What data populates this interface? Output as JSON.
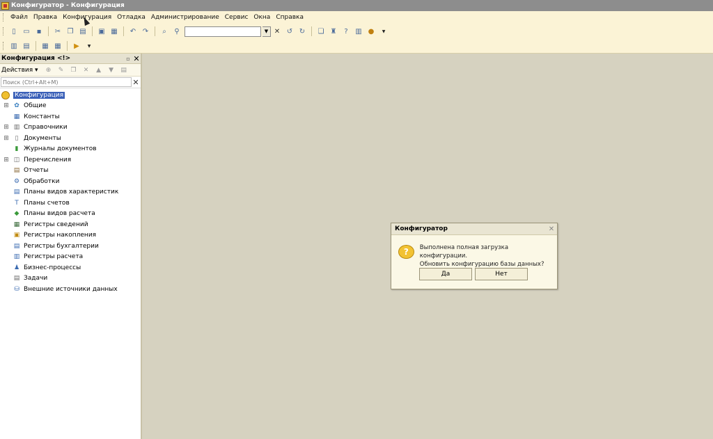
{
  "window": {
    "title": "Конфигуратор - Конфигурация"
  },
  "menu": [
    "Файл",
    "Правка",
    "Конфигурация",
    "Отладка",
    "Администрирование",
    "Сервис",
    "Окна",
    "Справка"
  ],
  "panel": {
    "title": "Конфигурация <!>",
    "actions_label": "Действия",
    "search_placeholder": "Поиск (Ctrl+Alt+M)"
  },
  "tree": {
    "root": "Конфигурация",
    "items": [
      {
        "label": "Общие",
        "expandable": true,
        "icon": "common-icon"
      },
      {
        "label": "Константы",
        "expandable": false,
        "icon": "constants-icon"
      },
      {
        "label": "Справочники",
        "expandable": true,
        "icon": "catalogs-icon"
      },
      {
        "label": "Документы",
        "expandable": true,
        "icon": "documents-icon"
      },
      {
        "label": "Журналы документов",
        "expandable": false,
        "icon": "journals-icon"
      },
      {
        "label": "Перечисления",
        "expandable": true,
        "icon": "enums-icon"
      },
      {
        "label": "Отчеты",
        "expandable": false,
        "icon": "reports-icon"
      },
      {
        "label": "Обработки",
        "expandable": false,
        "icon": "processing-icon"
      },
      {
        "label": "Планы видов характеристик",
        "expandable": false,
        "icon": "chart-of-characteristics-icon"
      },
      {
        "label": "Планы счетов",
        "expandable": false,
        "icon": "chart-of-accounts-icon"
      },
      {
        "label": "Планы видов расчета",
        "expandable": false,
        "icon": "calculation-types-icon"
      },
      {
        "label": "Регистры сведений",
        "expandable": false,
        "icon": "info-registers-icon"
      },
      {
        "label": "Регистры накопления",
        "expandable": false,
        "icon": "accumulation-registers-icon"
      },
      {
        "label": "Регистры бухгалтерии",
        "expandable": false,
        "icon": "accounting-registers-icon"
      },
      {
        "label": "Регистры расчета",
        "expandable": false,
        "icon": "calculation-registers-icon"
      },
      {
        "label": "Бизнес-процессы",
        "expandable": false,
        "icon": "business-processes-icon"
      },
      {
        "label": "Задачи",
        "expandable": false,
        "icon": "tasks-icon"
      },
      {
        "label": "Внешние источники данных",
        "expandable": false,
        "icon": "external-sources-icon"
      }
    ]
  },
  "dialog": {
    "title": "Конфигуратор",
    "line1": "Выполнена полная загрузка конфигурации.",
    "line2": "Обновить конфигурацию базы данных?",
    "yes": "Да",
    "no": "Нет"
  }
}
